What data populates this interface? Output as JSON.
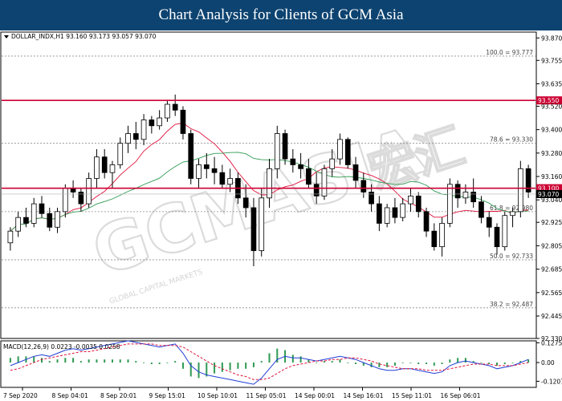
{
  "header": {
    "title": "Chart Analysis for Clients of GCM Asia"
  },
  "watermark": {
    "brand": "GCMASIA",
    "brand_cn": "宏汇",
    "tagline": "GLOBAL CAPITAL MARKETS"
  },
  "chart_data": [
    {
      "type": "candlestick",
      "symbol_info": "DOLLAR_INDX,H1  93.160 93.173 93.057 93.070",
      "ylim": [
        92.33,
        93.9
      ],
      "y_ticks": [
        "93.870",
        "93.755",
        "93.635",
        "93.520",
        "93.400",
        "93.280",
        "93.160",
        "93.040",
        "92.925",
        "92.805",
        "92.685",
        "92.565",
        "92.445",
        "92.330"
      ],
      "y_tick_values": [
        93.87,
        93.755,
        93.635,
        93.52,
        93.4,
        93.28,
        93.16,
        93.04,
        92.925,
        92.805,
        92.685,
        92.565,
        92.445,
        92.33
      ],
      "x_labels": [
        "7 Sep 2020",
        "8 Sep 04:01",
        "8 Sep 20:01",
        "9 Sep 15:01",
        "10 Sep 10:01",
        "11 Sep 05:01",
        "14 Sep 00:01",
        "14 Sep 16:01",
        "15 Sep 11:01",
        "16 Sep 06:01"
      ],
      "horizontal_lines": [
        {
          "label": "93.550",
          "value": 93.55,
          "color": "#cc0033"
        },
        {
          "label": "93.100",
          "value": 93.1,
          "color": "#cc0033"
        }
      ],
      "fibonacci_levels": [
        {
          "label": "100.0 = 93.777",
          "value": 93.777
        },
        {
          "label": "78.6 = 93.330",
          "value": 93.33
        },
        {
          "label": "61.8 = 92.980",
          "value": 92.98
        },
        {
          "label": "50.0 = 92.733",
          "value": 92.733
        },
        {
          "label": "38.2 = 92.487",
          "value": 92.487
        }
      ],
      "current_price": {
        "label": "93.070",
        "value": 93.07
      },
      "candles": [
        [
          92.82,
          92.9,
          92.78,
          92.88
        ],
        [
          92.88,
          92.98,
          92.85,
          92.95
        ],
        [
          92.95,
          93.0,
          92.9,
          92.92
        ],
        [
          92.92,
          93.05,
          92.9,
          93.02
        ],
        [
          93.02,
          93.06,
          92.95,
          92.97
        ],
        [
          92.97,
          93.0,
          92.88,
          92.9
        ],
        [
          92.9,
          93.0,
          92.87,
          92.98
        ],
        [
          92.98,
          93.12,
          92.95,
          93.1
        ],
        [
          93.1,
          93.14,
          93.05,
          93.08
        ],
        [
          93.08,
          93.1,
          92.98,
          93.02
        ],
        [
          93.02,
          93.18,
          93.0,
          93.15
        ],
        [
          93.15,
          93.3,
          93.1,
          93.26
        ],
        [
          93.26,
          93.3,
          93.15,
          93.18
        ],
        [
          93.18,
          93.24,
          93.1,
          93.22
        ],
        [
          93.22,
          93.36,
          93.2,
          93.33
        ],
        [
          93.33,
          93.42,
          93.28,
          93.38
        ],
        [
          93.38,
          93.44,
          93.3,
          93.35
        ],
        [
          93.35,
          93.48,
          93.32,
          93.45
        ],
        [
          93.45,
          93.47,
          93.38,
          93.42
        ],
        [
          93.42,
          93.5,
          93.4,
          93.46
        ],
        [
          93.46,
          93.55,
          93.44,
          93.53
        ],
        [
          93.53,
          93.58,
          93.47,
          93.5
        ],
        [
          93.5,
          93.52,
          93.35,
          93.38
        ],
        [
          93.38,
          93.4,
          93.12,
          93.15
        ],
        [
          93.15,
          93.25,
          93.1,
          93.22
        ],
        [
          93.22,
          93.28,
          93.15,
          93.2
        ],
        [
          93.2,
          93.26,
          93.12,
          93.18
        ],
        [
          93.18,
          93.22,
          93.1,
          93.12
        ],
        [
          93.12,
          93.2,
          93.08,
          93.15
        ],
        [
          93.15,
          93.18,
          93.02,
          93.05
        ],
        [
          93.05,
          93.12,
          92.95,
          93.0
        ],
        [
          93.0,
          93.05,
          92.7,
          92.78
        ],
        [
          92.78,
          93.1,
          92.75,
          93.05
        ],
        [
          93.05,
          93.25,
          93.0,
          93.2
        ],
        [
          93.2,
          93.42,
          93.15,
          93.38
        ],
        [
          93.38,
          93.4,
          93.22,
          93.25
        ],
        [
          93.25,
          93.3,
          93.18,
          93.22
        ],
        [
          93.22,
          93.28,
          93.15,
          93.2
        ],
        [
          93.2,
          93.25,
          93.1,
          93.12
        ],
        [
          93.12,
          93.18,
          93.02,
          93.06
        ],
        [
          93.06,
          93.22,
          93.04,
          93.2
        ],
        [
          93.2,
          93.3,
          93.16,
          93.25
        ],
        [
          93.25,
          93.38,
          93.22,
          93.35
        ],
        [
          93.35,
          93.36,
          93.2,
          93.22
        ],
        [
          93.22,
          93.26,
          93.1,
          93.14
        ],
        [
          93.14,
          93.18,
          93.05,
          93.08
        ],
        [
          93.08,
          93.12,
          92.98,
          93.02
        ],
        [
          93.02,
          93.06,
          92.88,
          92.92
        ],
        [
          92.92,
          93.02,
          92.9,
          93.0
        ],
        [
          93.0,
          93.05,
          92.92,
          92.95
        ],
        [
          92.95,
          93.05,
          92.93,
          93.02
        ],
        [
          93.02,
          93.1,
          92.98,
          93.06
        ],
        [
          93.06,
          93.08,
          92.95,
          92.98
        ],
        [
          92.98,
          93.0,
          92.85,
          92.88
        ],
        [
          92.88,
          92.92,
          92.78,
          92.8
        ],
        [
          92.8,
          92.95,
          92.75,
          92.92
        ],
        [
          92.92,
          93.15,
          92.9,
          93.12
        ],
        [
          93.12,
          93.14,
          93.0,
          93.05
        ],
        [
          93.05,
          93.12,
          93.02,
          93.08
        ],
        [
          93.08,
          93.15,
          93.0,
          93.03
        ],
        [
          93.03,
          93.06,
          92.92,
          92.95
        ],
        [
          92.95,
          92.98,
          92.85,
          92.9
        ],
        [
          92.9,
          92.92,
          92.76,
          92.8
        ],
        [
          92.8,
          92.98,
          92.78,
          92.96
        ],
        [
          92.96,
          93.0,
          92.9,
          92.98
        ],
        [
          92.98,
          93.24,
          92.95,
          93.2
        ],
        [
          93.2,
          93.22,
          93.05,
          93.08
        ]
      ]
    },
    {
      "type": "macd",
      "label": "MACD(12,26,9) 0.0223 -0.0035 0.0258",
      "ylim": [
        -0.16,
        0.14
      ],
      "y_ticks": [
        "0.1275",
        "0.00",
        "-0.1207"
      ],
      "y_tick_values": [
        0.1275,
        0.0,
        -0.1207
      ],
      "series": [
        {
          "values": [
            -0.02,
            0.0,
            0.02,
            0.04,
            0.05,
            0.04,
            0.06,
            0.08,
            0.09,
            0.08,
            0.09,
            0.1,
            0.11,
            0.12,
            0.13,
            0.14,
            0.13,
            0.12,
            0.11,
            0.1,
            0.11,
            0.12,
            0.06,
            -0.02,
            -0.06,
            -0.08,
            -0.09,
            -0.1,
            -0.11,
            -0.12,
            -0.13,
            -0.14,
            -0.1,
            -0.04,
            0.02,
            0.04,
            0.03,
            0.03,
            0.02,
            0.01,
            0.02,
            0.03,
            0.04,
            0.03,
            0.02,
            0.0,
            -0.02,
            -0.04,
            -0.05,
            -0.05,
            -0.04,
            -0.04,
            -0.05,
            -0.06,
            -0.07,
            -0.06,
            -0.02,
            0.0,
            0.01,
            0.0,
            -0.01,
            -0.02,
            -0.04,
            -0.03,
            -0.02,
            0.0,
            0.02
          ]
        },
        {
          "values": [
            -0.05,
            -0.04,
            -0.02,
            0.0,
            0.02,
            0.03,
            0.04,
            0.05,
            0.06,
            0.07,
            0.07,
            0.08,
            0.09,
            0.1,
            0.11,
            0.12,
            0.12,
            0.12,
            0.12,
            0.11,
            0.11,
            0.11,
            0.1,
            0.07,
            0.04,
            0.01,
            -0.02,
            -0.04,
            -0.06,
            -0.08,
            -0.09,
            -0.11,
            -0.11,
            -0.1,
            -0.07,
            -0.04,
            -0.02,
            -0.01,
            0.0,
            0.01,
            0.01,
            0.02,
            0.02,
            0.03,
            0.03,
            0.02,
            0.01,
            -0.01,
            -0.02,
            -0.03,
            -0.04,
            -0.04,
            -0.04,
            -0.05,
            -0.05,
            -0.05,
            -0.04,
            -0.03,
            -0.02,
            -0.01,
            -0.01,
            -0.01,
            -0.02,
            -0.02,
            -0.02,
            -0.01,
            0.0
          ]
        },
        {
          "values": [
            0.03,
            0.04,
            0.04,
            0.04,
            0.03,
            0.01,
            0.02,
            0.03,
            0.03,
            0.01,
            0.02,
            0.02,
            0.02,
            0.02,
            0.02,
            0.02,
            0.01,
            0.0,
            -0.01,
            -0.01,
            0.0,
            0.01,
            -0.04,
            -0.09,
            -0.1,
            -0.09,
            -0.07,
            -0.06,
            -0.05,
            -0.04,
            -0.04,
            -0.03,
            0.01,
            0.06,
            0.09,
            0.08,
            0.05,
            0.04,
            0.02,
            0.0,
            0.01,
            0.01,
            0.02,
            0.0,
            -0.01,
            -0.02,
            -0.03,
            -0.03,
            -0.03,
            -0.02,
            0.0,
            0.0,
            -0.01,
            -0.01,
            -0.02,
            -0.01,
            0.02,
            0.03,
            0.03,
            0.01,
            0.0,
            -0.01,
            -0.02,
            -0.01,
            0.0,
            0.01,
            0.02
          ]
        }
      ]
    }
  ]
}
